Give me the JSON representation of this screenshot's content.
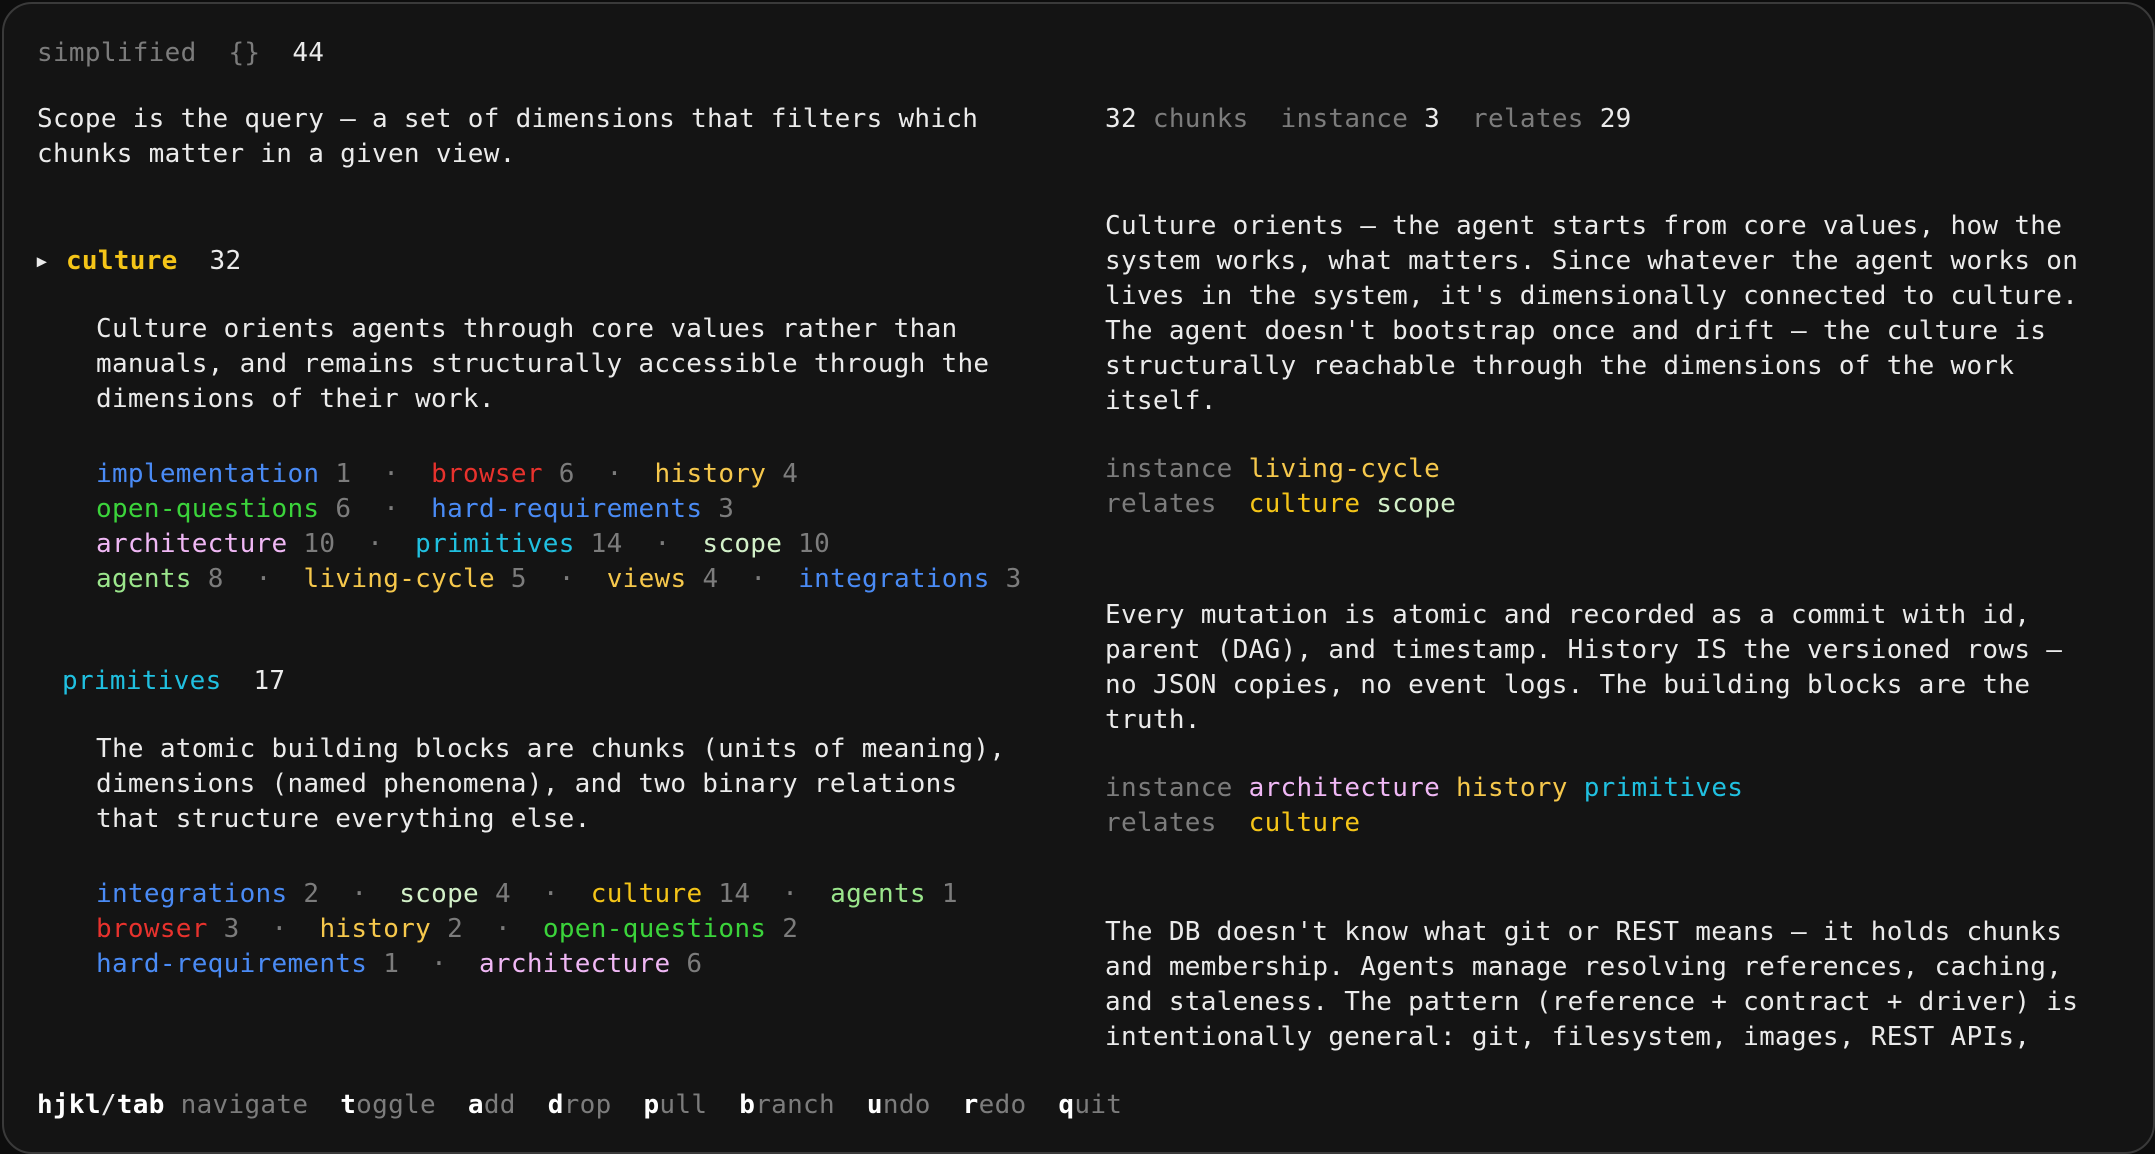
{
  "colors": {
    "background": "#141414",
    "text": "#ebebeb",
    "dim": "#7c7c7c",
    "culture": "#f5c518",
    "history": "#f6c84c",
    "living-cycle": "#f6c84c",
    "views": "#f6c84c",
    "implementation": "#4a8bf5",
    "hard-requirements": "#4a8bf5",
    "integrations": "#4a8bf5",
    "browser": "#e8322d",
    "open-questions": "#3bd43b",
    "architecture": "#f0b8f5",
    "primitives": "#20c0e0",
    "scope": "#d2f0c8",
    "agents": "#9be68c"
  },
  "header": {
    "mode": "simplified",
    "braces": "{}",
    "count": "44"
  },
  "left": {
    "intro_lines": [
      "Scope is the query — a set of dimensions that filters which",
      "chunks matter in a given view."
    ],
    "groups": [
      {
        "marker": "▸",
        "name": "culture",
        "count": "32",
        "description": [
          "Culture orients agents through core values rather than",
          "manuals, and remains structurally accessible through the",
          "dimensions of their work."
        ],
        "rows": [
          [
            {
              "name": "implementation",
              "count": "1"
            },
            {
              "name": "browser",
              "count": "6"
            },
            {
              "name": "history",
              "count": "4"
            }
          ],
          [
            {
              "name": "open-questions",
              "count": "6"
            },
            {
              "name": "hard-requirements",
              "count": "3"
            }
          ],
          [
            {
              "name": "architecture",
              "count": "10"
            },
            {
              "name": "primitives",
              "count": "14"
            },
            {
              "name": "scope",
              "count": "10"
            }
          ],
          [
            {
              "name": "agents",
              "count": "8"
            },
            {
              "name": "living-cycle",
              "count": "5"
            },
            {
              "name": "views",
              "count": "4"
            },
            {
              "name": "integrations",
              "count": "3"
            }
          ]
        ]
      },
      {
        "marker": "",
        "name": "primitives",
        "count": "17",
        "description": [
          "The atomic building blocks are chunks (units of meaning),",
          "dimensions (named phenomena), and two binary relations",
          "that structure everything else."
        ],
        "rows": [
          [
            {
              "name": "integrations",
              "count": "2"
            },
            {
              "name": "scope",
              "count": "4"
            },
            {
              "name": "culture",
              "count": "14"
            },
            {
              "name": "agents",
              "count": "1"
            }
          ],
          [
            {
              "name": "browser",
              "count": "3"
            },
            {
              "name": "history",
              "count": "2"
            },
            {
              "name": "open-questions",
              "count": "2"
            }
          ],
          [
            {
              "name": "hard-requirements",
              "count": "1"
            },
            {
              "name": "architecture",
              "count": "6"
            }
          ]
        ]
      }
    ]
  },
  "right": {
    "stats": [
      {
        "value": "32",
        "label": "chunks"
      },
      {
        "label": "instance",
        "value": "3"
      },
      {
        "label": "relates",
        "value": "29"
      }
    ],
    "instance_label": "instance",
    "relates_label": "relates",
    "chunks": [
      {
        "text": [
          "Culture orients — the agent starts from core values, how the",
          "system works, what matters. Since whatever the agent works on",
          "lives in the system, it's dimensionally connected to culture.",
          "The agent doesn't bootstrap once and drift — the culture is",
          "structurally reachable through the dimensions of the work",
          "itself."
        ],
        "instance": [
          "living-cycle"
        ],
        "relates": [
          "culture",
          "scope"
        ]
      },
      {
        "text": [
          "Every mutation is atomic and recorded as a commit with id,",
          "parent (DAG), and timestamp. History IS the versioned rows —",
          "no JSON copies, no event logs. The building blocks are the",
          "truth."
        ],
        "instance": [
          "architecture",
          "history",
          "primitives"
        ],
        "relates": [
          "culture"
        ]
      },
      {
        "text": [
          "The DB doesn't know what git or REST means — it holds chunks",
          "and membership. Agents manage resolving references, caching,",
          "and staleness. The pattern (reference + contract + driver) is",
          "intentionally general: git, filesystem, images, REST APIs,"
        ],
        "instance": [],
        "relates": []
      }
    ]
  },
  "footer": {
    "items": [
      {
        "key": "hjkl",
        "sep": "/",
        "key2": "tab",
        "rest": "navigate"
      },
      {
        "key": "t",
        "rest": "oggle"
      },
      {
        "key": "a",
        "rest": "dd"
      },
      {
        "key": "d",
        "rest": "rop"
      },
      {
        "key": "p",
        "rest": "ull"
      },
      {
        "key": "b",
        "rest": "ranch"
      },
      {
        "key": "u",
        "rest": "ndo"
      },
      {
        "key": "r",
        "rest": "edo"
      },
      {
        "key": "q",
        "rest": "uit"
      }
    ]
  }
}
